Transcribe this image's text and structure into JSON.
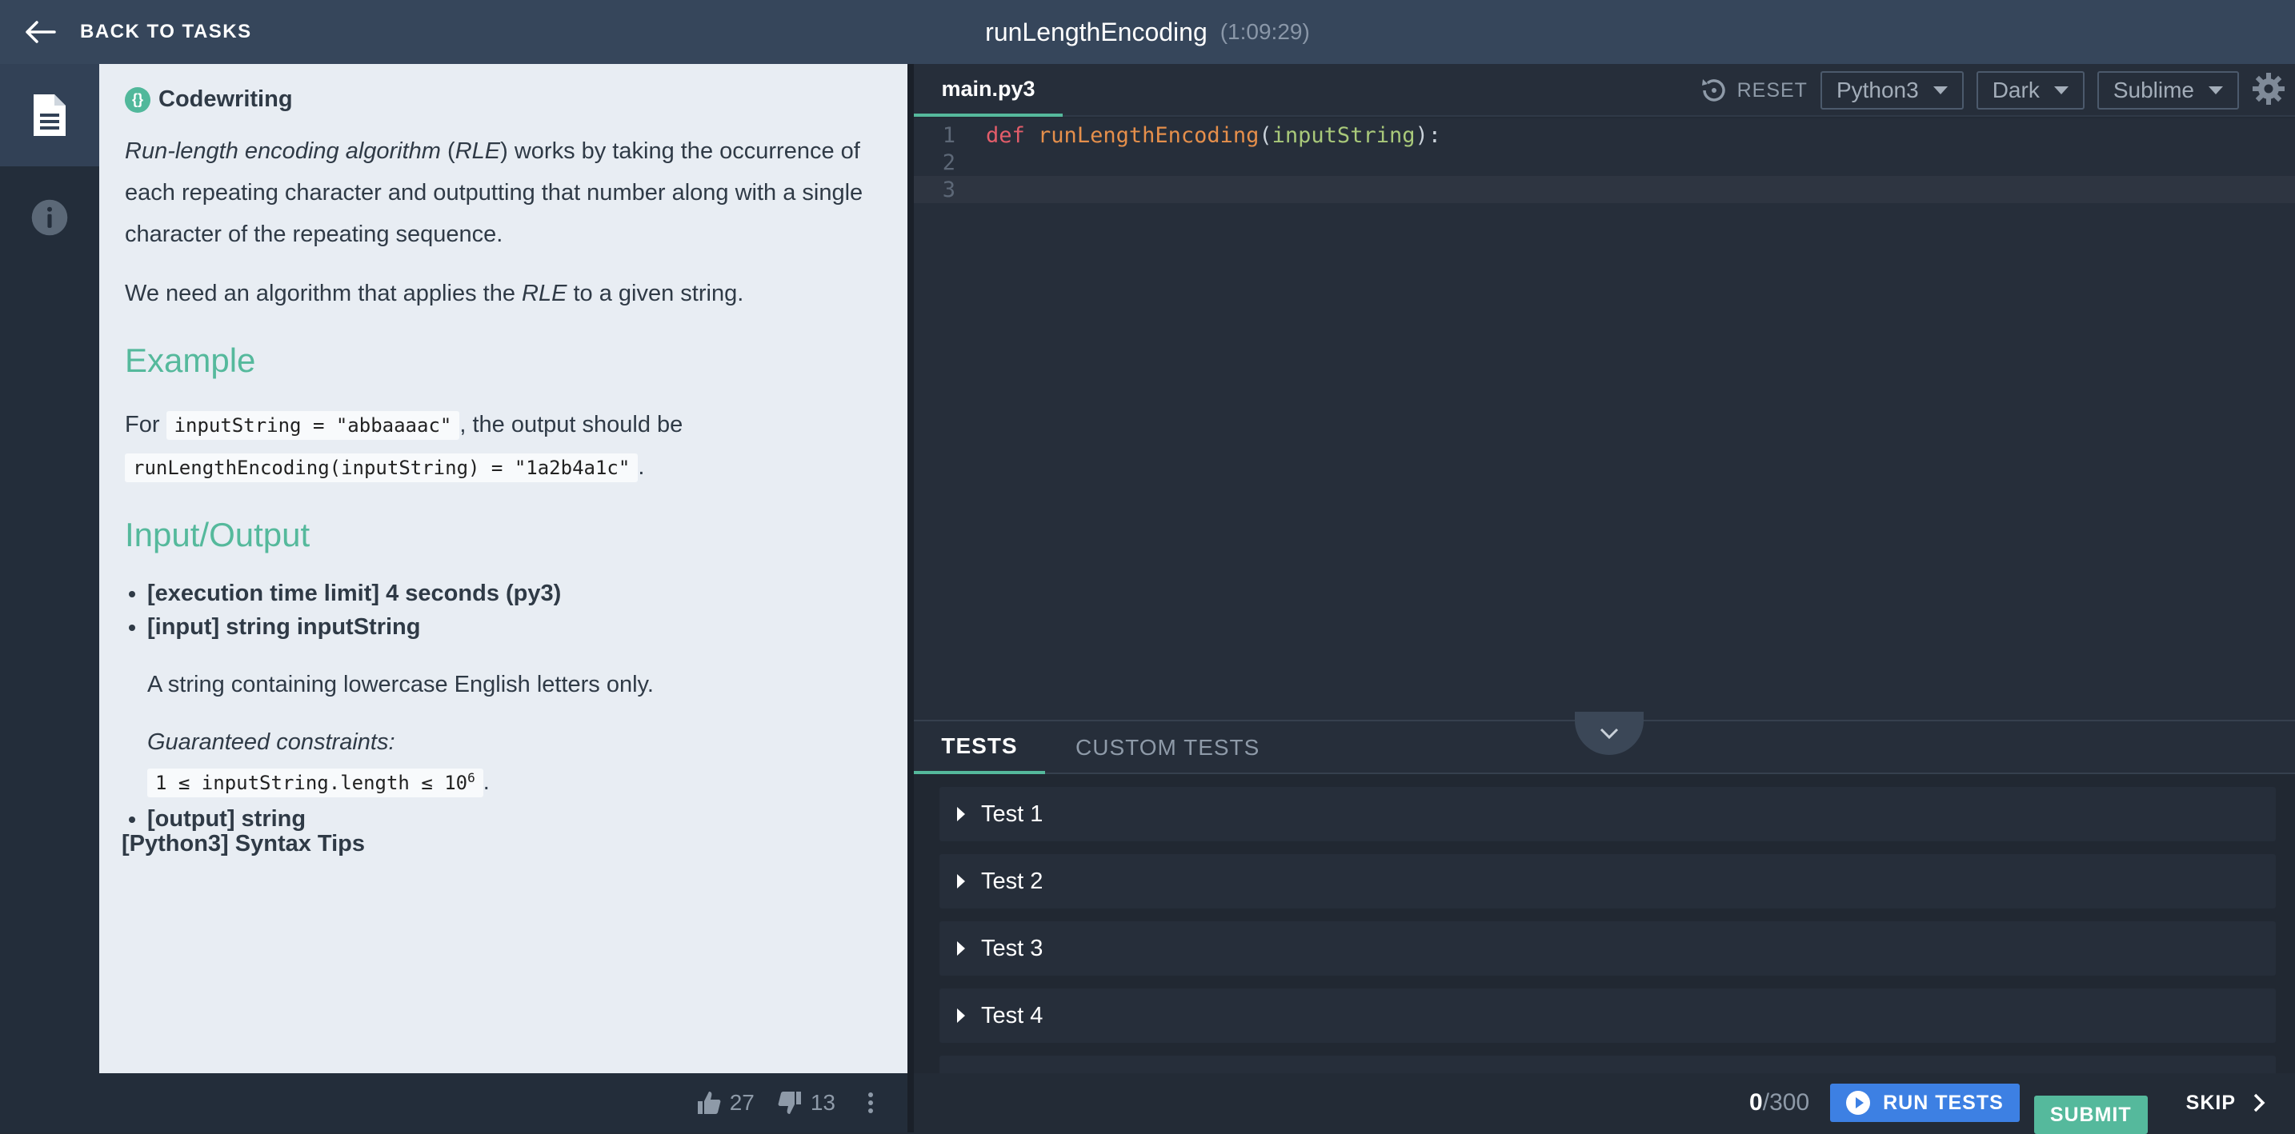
{
  "header": {
    "back_label": "BACK TO TASKS",
    "title": "runLengthEncoding",
    "timer": "(1:09:29)"
  },
  "description": {
    "type_label": "Codewriting",
    "para1_a": "Run-length encoding algorithm",
    "para1_b": " (",
    "para1_c": "RLE",
    "para1_d": ") works by taking the occurrence of each repeating character and outputting that number along with a single character of the repeating sequence.",
    "para2_a": "We need an algorithm that applies the ",
    "para2_b": "RLE",
    "para2_c": " to a given string.",
    "example_heading": "Example",
    "ex_for": "For ",
    "ex_code1": "inputString = \"abbaaaac\"",
    "ex_mid": ", the output should be",
    "ex_code2": "runLengthEncoding(inputString) = \"1a2b4a1c\"",
    "ex_end": ".",
    "io_heading": "Input/Output",
    "time_limit": "[execution time limit] 4 seconds (py3)",
    "input_label": "[input] string inputString",
    "input_desc": "A string containing lowercase English letters only.",
    "constraints_label": "Guaranteed constraints:",
    "constraint_code": "1 ≤ inputString.length ≤ 10",
    "constraint_exp": "6",
    "constraint_end": ".",
    "output_label": "[output] string",
    "syntax_tips": "[Python3] Syntax Tips",
    "likes": "27",
    "dislikes": "13"
  },
  "editor": {
    "file_tab": "main.py3",
    "reset_label": "RESET",
    "language": "Python3",
    "theme": "Dark",
    "keymap": "Sublime",
    "line_numbers": [
      "1",
      "2",
      "3"
    ],
    "code_kw": "def",
    "code_fn": "runLengthEncoding",
    "code_open": "(",
    "code_param": "inputString",
    "code_close": "):"
  },
  "tests": {
    "tab_tests": "TESTS",
    "tab_custom": "CUSTOM TESTS",
    "items": [
      "Test 1",
      "Test 2",
      "Test 3",
      "Test 4"
    ]
  },
  "footer": {
    "score_value": "0",
    "score_total": "/300",
    "run_label": "RUN TESTS",
    "submit_label": "SUBMIT",
    "skip_label": "SKIP"
  },
  "colors": {
    "accent_green": "#55b99c",
    "run_blue": "#3d80e3",
    "header_bg": "#36465b"
  }
}
